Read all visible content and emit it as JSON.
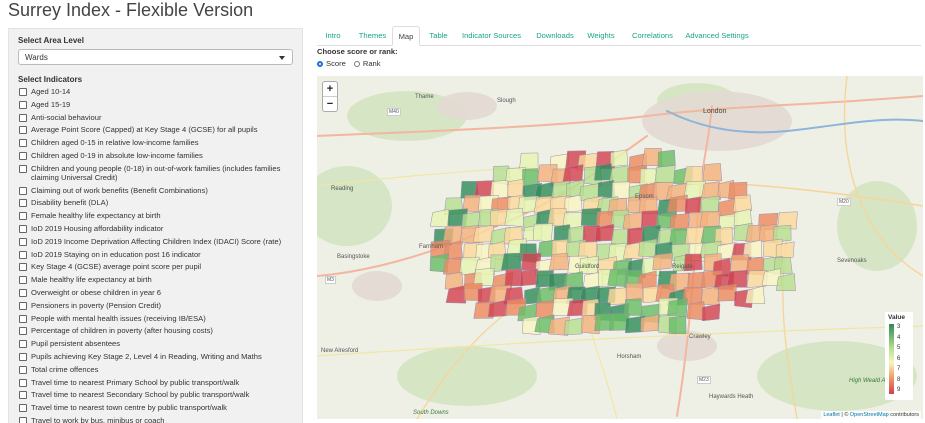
{
  "app": {
    "title": "Surrey Index - Flexible Version"
  },
  "sidebar": {
    "area_label": "Select Area Level",
    "area_value": "Wards",
    "indicators_label": "Select Indicators",
    "indicators": [
      "Aged 10-14",
      "Aged 15-19",
      "Anti-social behaviour",
      "Average Point Score (Capped) at Key Stage 4 (GCSE) for all pupils",
      "Children aged 0-15 in relative low-income families",
      "Children aged 0-19 in absolute low-income families",
      "Children and young people (0-18) in out-of-work families (includes families claiming Universal Credit)",
      "Claiming out of work benefits (Benefit Combinations)",
      "Disability benefit (DLA)",
      "Female healthy life expectancy at birth",
      "IoD 2019 Housing affordability indicator",
      "IoD 2019 Income Deprivation Affecting Children Index (IDACI) Score (rate)",
      "IoD 2019 Staying on in education post 16 indicator",
      "Key Stage 4 (GCSE) average point score per pupil",
      "Male healthy life expectancy at birth",
      "Overweight or obese children in year 6",
      "Pensioners in poverty (Pension Credit)",
      "People with mental health issues (receiving IB/ESA)",
      "Percentage of children in poverty (after housing costs)",
      "Pupil persistent absentees",
      "Pupils achieving Key Stage 2, Level 4 in Reading, Writing and Maths",
      "Total crime offences",
      "Travel time to nearest Primary School by public transport/walk",
      "Travel time to nearest Secondary School by public transport/walk",
      "Travel time to nearest town centre by public transport/walk",
      "Travel to work by bus, minibus or coach"
    ]
  },
  "tabs": [
    {
      "label": "Intro"
    },
    {
      "label": "Themes"
    },
    {
      "label": "Map"
    },
    {
      "label": "Table"
    },
    {
      "label": "Indicator Sources"
    },
    {
      "label": "Downloads"
    },
    {
      "label": "Weights"
    },
    {
      "label": "Correlations"
    },
    {
      "label": "Advanced Settings"
    }
  ],
  "active_tab": "Map",
  "score_rank": {
    "label": "Choose score or rank:",
    "options": [
      "Score",
      "Rank"
    ],
    "selected": "Score"
  },
  "map": {
    "zoom_in": "+",
    "zoom_out": "−",
    "place_labels": [
      "London",
      "Slough",
      "Thame",
      "M40",
      "M3",
      "M20",
      "M23",
      "Farnham",
      "Guildford",
      "Epsom",
      "Reigate",
      "Crawley",
      "Haywards Heath",
      "New Alresford",
      "South Downs",
      "High Weald AONB",
      "Horsham",
      "Basingstoke",
      "Reading",
      "Sevenoaks"
    ],
    "legend": {
      "title": "Value",
      "values": [
        "3",
        "4",
        "5",
        "6",
        "7",
        "8",
        "9"
      ]
    },
    "attribution": {
      "leaflet": "Leaflet",
      "sep": " | © ",
      "osm": "OpenStreetMap",
      "suffix": " contributors"
    }
  },
  "colors": {
    "accent": "#17a589",
    "low": "#2e8b57",
    "high": "#d2404d"
  }
}
